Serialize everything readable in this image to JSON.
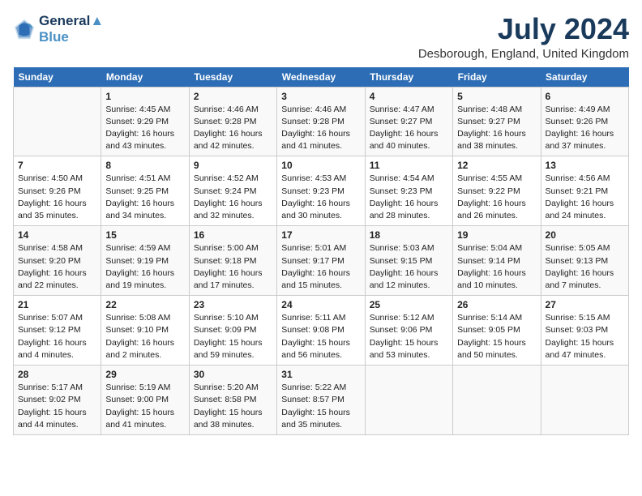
{
  "header": {
    "logo_line1": "General",
    "logo_line2": "Blue",
    "month_year": "July 2024",
    "location": "Desborough, England, United Kingdom"
  },
  "weekdays": [
    "Sunday",
    "Monday",
    "Tuesday",
    "Wednesday",
    "Thursday",
    "Friday",
    "Saturday"
  ],
  "weeks": [
    [
      {
        "day": "",
        "sunrise": "",
        "sunset": "",
        "daylight": ""
      },
      {
        "day": "1",
        "sunrise": "Sunrise: 4:45 AM",
        "sunset": "Sunset: 9:29 PM",
        "daylight": "Daylight: 16 hours and 43 minutes."
      },
      {
        "day": "2",
        "sunrise": "Sunrise: 4:46 AM",
        "sunset": "Sunset: 9:28 PM",
        "daylight": "Daylight: 16 hours and 42 minutes."
      },
      {
        "day": "3",
        "sunrise": "Sunrise: 4:46 AM",
        "sunset": "Sunset: 9:28 PM",
        "daylight": "Daylight: 16 hours and 41 minutes."
      },
      {
        "day": "4",
        "sunrise": "Sunrise: 4:47 AM",
        "sunset": "Sunset: 9:27 PM",
        "daylight": "Daylight: 16 hours and 40 minutes."
      },
      {
        "day": "5",
        "sunrise": "Sunrise: 4:48 AM",
        "sunset": "Sunset: 9:27 PM",
        "daylight": "Daylight: 16 hours and 38 minutes."
      },
      {
        "day": "6",
        "sunrise": "Sunrise: 4:49 AM",
        "sunset": "Sunset: 9:26 PM",
        "daylight": "Daylight: 16 hours and 37 minutes."
      }
    ],
    [
      {
        "day": "7",
        "sunrise": "Sunrise: 4:50 AM",
        "sunset": "Sunset: 9:26 PM",
        "daylight": "Daylight: 16 hours and 35 minutes."
      },
      {
        "day": "8",
        "sunrise": "Sunrise: 4:51 AM",
        "sunset": "Sunset: 9:25 PM",
        "daylight": "Daylight: 16 hours and 34 minutes."
      },
      {
        "day": "9",
        "sunrise": "Sunrise: 4:52 AM",
        "sunset": "Sunset: 9:24 PM",
        "daylight": "Daylight: 16 hours and 32 minutes."
      },
      {
        "day": "10",
        "sunrise": "Sunrise: 4:53 AM",
        "sunset": "Sunset: 9:23 PM",
        "daylight": "Daylight: 16 hours and 30 minutes."
      },
      {
        "day": "11",
        "sunrise": "Sunrise: 4:54 AM",
        "sunset": "Sunset: 9:23 PM",
        "daylight": "Daylight: 16 hours and 28 minutes."
      },
      {
        "day": "12",
        "sunrise": "Sunrise: 4:55 AM",
        "sunset": "Sunset: 9:22 PM",
        "daylight": "Daylight: 16 hours and 26 minutes."
      },
      {
        "day": "13",
        "sunrise": "Sunrise: 4:56 AM",
        "sunset": "Sunset: 9:21 PM",
        "daylight": "Daylight: 16 hours and 24 minutes."
      }
    ],
    [
      {
        "day": "14",
        "sunrise": "Sunrise: 4:58 AM",
        "sunset": "Sunset: 9:20 PM",
        "daylight": "Daylight: 16 hours and 22 minutes."
      },
      {
        "day": "15",
        "sunrise": "Sunrise: 4:59 AM",
        "sunset": "Sunset: 9:19 PM",
        "daylight": "Daylight: 16 hours and 19 minutes."
      },
      {
        "day": "16",
        "sunrise": "Sunrise: 5:00 AM",
        "sunset": "Sunset: 9:18 PM",
        "daylight": "Daylight: 16 hours and 17 minutes."
      },
      {
        "day": "17",
        "sunrise": "Sunrise: 5:01 AM",
        "sunset": "Sunset: 9:17 PM",
        "daylight": "Daylight: 16 hours and 15 minutes."
      },
      {
        "day": "18",
        "sunrise": "Sunrise: 5:03 AM",
        "sunset": "Sunset: 9:15 PM",
        "daylight": "Daylight: 16 hours and 12 minutes."
      },
      {
        "day": "19",
        "sunrise": "Sunrise: 5:04 AM",
        "sunset": "Sunset: 9:14 PM",
        "daylight": "Daylight: 16 hours and 10 minutes."
      },
      {
        "day": "20",
        "sunrise": "Sunrise: 5:05 AM",
        "sunset": "Sunset: 9:13 PM",
        "daylight": "Daylight: 16 hours and 7 minutes."
      }
    ],
    [
      {
        "day": "21",
        "sunrise": "Sunrise: 5:07 AM",
        "sunset": "Sunset: 9:12 PM",
        "daylight": "Daylight: 16 hours and 4 minutes."
      },
      {
        "day": "22",
        "sunrise": "Sunrise: 5:08 AM",
        "sunset": "Sunset: 9:10 PM",
        "daylight": "Daylight: 16 hours and 2 minutes."
      },
      {
        "day": "23",
        "sunrise": "Sunrise: 5:10 AM",
        "sunset": "Sunset: 9:09 PM",
        "daylight": "Daylight: 15 hours and 59 minutes."
      },
      {
        "day": "24",
        "sunrise": "Sunrise: 5:11 AM",
        "sunset": "Sunset: 9:08 PM",
        "daylight": "Daylight: 15 hours and 56 minutes."
      },
      {
        "day": "25",
        "sunrise": "Sunrise: 5:12 AM",
        "sunset": "Sunset: 9:06 PM",
        "daylight": "Daylight: 15 hours and 53 minutes."
      },
      {
        "day": "26",
        "sunrise": "Sunrise: 5:14 AM",
        "sunset": "Sunset: 9:05 PM",
        "daylight": "Daylight: 15 hours and 50 minutes."
      },
      {
        "day": "27",
        "sunrise": "Sunrise: 5:15 AM",
        "sunset": "Sunset: 9:03 PM",
        "daylight": "Daylight: 15 hours and 47 minutes."
      }
    ],
    [
      {
        "day": "28",
        "sunrise": "Sunrise: 5:17 AM",
        "sunset": "Sunset: 9:02 PM",
        "daylight": "Daylight: 15 hours and 44 minutes."
      },
      {
        "day": "29",
        "sunrise": "Sunrise: 5:19 AM",
        "sunset": "Sunset: 9:00 PM",
        "daylight": "Daylight: 15 hours and 41 minutes."
      },
      {
        "day": "30",
        "sunrise": "Sunrise: 5:20 AM",
        "sunset": "Sunset: 8:58 PM",
        "daylight": "Daylight: 15 hours and 38 minutes."
      },
      {
        "day": "31",
        "sunrise": "Sunrise: 5:22 AM",
        "sunset": "Sunset: 8:57 PM",
        "daylight": "Daylight: 15 hours and 35 minutes."
      },
      {
        "day": "",
        "sunrise": "",
        "sunset": "",
        "daylight": ""
      },
      {
        "day": "",
        "sunrise": "",
        "sunset": "",
        "daylight": ""
      },
      {
        "day": "",
        "sunrise": "",
        "sunset": "",
        "daylight": ""
      }
    ]
  ]
}
